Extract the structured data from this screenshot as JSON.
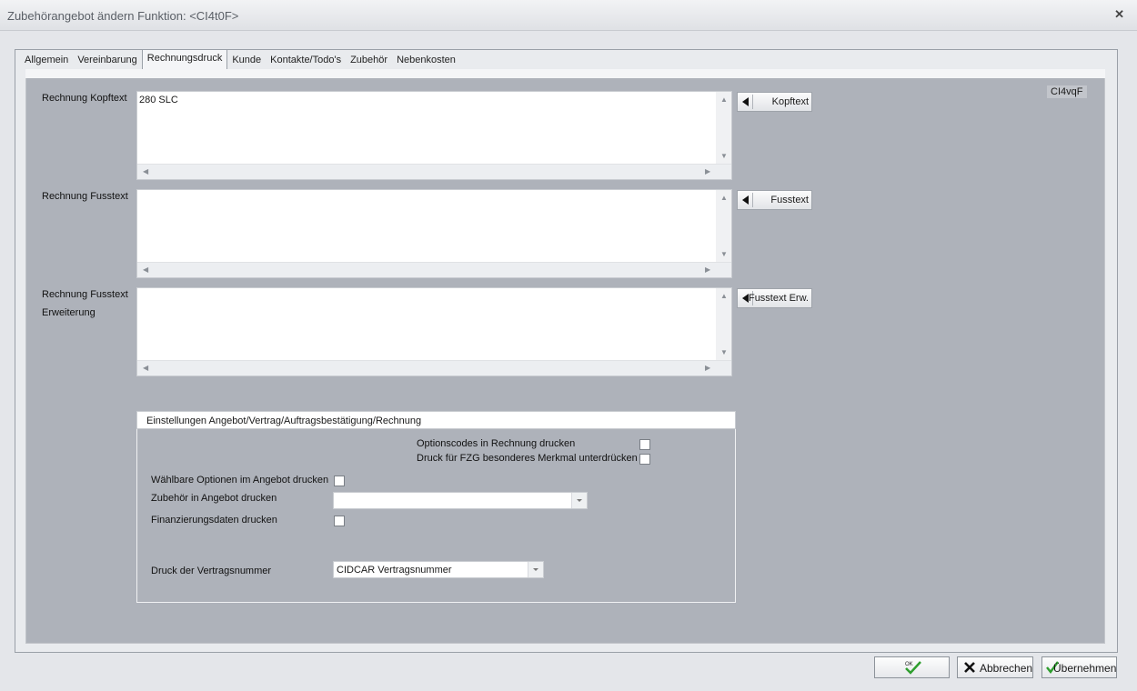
{
  "window": {
    "title": "Zubehörangebot ändern Funktion: <CI4t0F>",
    "close_glyph": "✕"
  },
  "tabs": [
    {
      "label": "Allgemein",
      "active": false
    },
    {
      "label": "Vereinbarung",
      "active": false
    },
    {
      "label": "Rechnungsdruck",
      "active": true
    },
    {
      "label": "Kunde",
      "active": false
    },
    {
      "label": "Kontakte/Todo's",
      "active": false
    },
    {
      "label": "Zubehör",
      "active": false
    },
    {
      "label": "Nebenkosten",
      "active": false
    }
  ],
  "panel": {
    "id_badge": "CI4vqF",
    "kopftext": {
      "label": "Rechnung Kopftext",
      "value": "280 SLC",
      "button": "Kopftext"
    },
    "fusstext": {
      "label": "Rechnung Fusstext",
      "value": "",
      "button": "Fusstext"
    },
    "fusstext_erw": {
      "label_line1": "Rechnung Fusstext",
      "label_line2": "Erweiterung",
      "value": "",
      "button": "Fusstext Erw."
    }
  },
  "settings": {
    "header": "Einstellungen Angebot/Vertrag/Auftragsbestätigung/Rechnung",
    "optionscodes_label": "Optionscodes in Rechnung drucken",
    "optionscodes_checked": false,
    "fzg_merkmal_label": "Druck für FZG besonderes Merkmal unterdrücken",
    "fzg_merkmal_checked": false,
    "waehlbare_label": "Wählbare Optionen im Angebot drucken",
    "waehlbare_checked": false,
    "zubehoer_label": "Zubehör in Angebot drucken",
    "zubehoer_value": "",
    "finanzierung_label": "Finanzierungsdaten drucken",
    "finanzierung_checked": false,
    "vertragsnummer_label": "Druck der Vertragsnummer",
    "vertragsnummer_value": "CIDCAR Vertragsnummer"
  },
  "buttons": {
    "ok": "OK",
    "cancel": "Abbrechen",
    "apply": "Übernehmen"
  },
  "colors": {
    "panel_bg": "#aeb2ba",
    "ok_check": "#2e9e2e"
  }
}
